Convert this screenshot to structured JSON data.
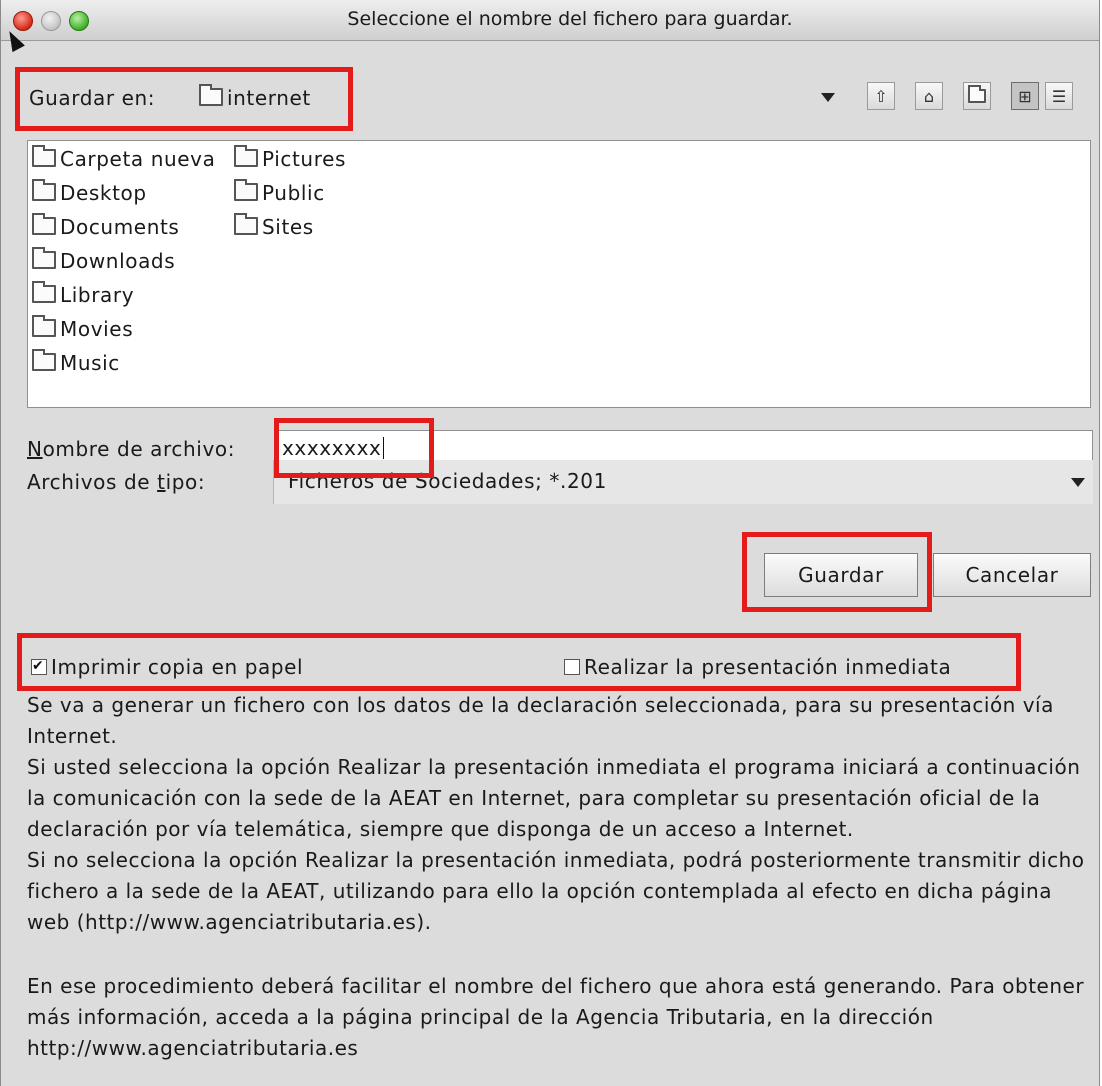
{
  "window": {
    "title": "Seleccione el nombre del fichero para guardar."
  },
  "save_in": {
    "label": "Guardar en:",
    "current_folder": "internet"
  },
  "toolbar": {
    "icons": [
      "up-folder-icon",
      "home-icon",
      "new-folder-icon",
      "list-view-icon",
      "details-view-icon"
    ]
  },
  "file_list": {
    "column1": [
      "Carpeta nueva",
      "Desktop",
      "Documents",
      "Downloads",
      "Library",
      "Movies",
      "Music"
    ],
    "column2": [
      "Pictures",
      "Public",
      "Sites"
    ]
  },
  "filename": {
    "label_mnemonic": "N",
    "label_rest": "ombre de archivo:",
    "value": "xxxxxxxx"
  },
  "filetype": {
    "label_before": "Archivos de ",
    "label_mnemonic": "t",
    "label_after": "ipo:",
    "selected": "Ficheros de Sociedades; *.201"
  },
  "buttons": {
    "save": "Guardar",
    "cancel": "Cancelar"
  },
  "options": {
    "print_copy": {
      "label": "Imprimir copia en papel",
      "checked": true
    },
    "immediate_submission": {
      "label": "Realizar la presentación inmediata",
      "checked": false
    }
  },
  "description": {
    "p1": "Se va a generar un fichero con los datos de la declaración seleccionada, para su presentación vía Internet.",
    "p2": "Si usted selecciona la opción Realizar la presentación inmediata el programa iniciará a continuación la comunicación con la sede de la AEAT en Internet, para completar su presentación oficial de la declaración por vía telemática, siempre que disponga de un acceso a Internet.",
    "p3": "Si no selecciona la opción Realizar la presentación inmediata, podrá posteriormente transmitir dicho fichero  a la sede de la AEAT, utilizando para ello la opción contemplada al efecto en dicha página web (http://www.agenciatributaria.es).",
    "p4": "En ese procedimiento deberá facilitar el nombre del fichero que ahora está generando. Para obtener más información, acceda a la página principal de la Agencia Tributaria, en la dirección http://www.agenciatributaria.es"
  },
  "colors": {
    "highlight": "#e31b1b",
    "window_bg": "#dcdcdc"
  }
}
